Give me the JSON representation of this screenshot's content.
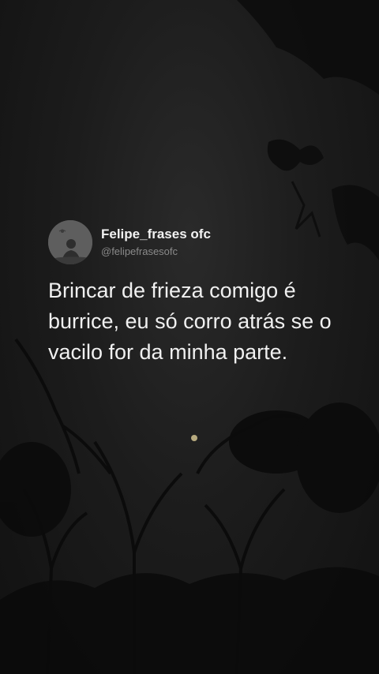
{
  "post": {
    "author_name": "Felipe_frases ofc",
    "author_handle": "@felipefrasesofc",
    "avatar_icon": "user-silhouette-icon",
    "quote_text": "Brincar de frieza comigo é burrice, eu só corro atrás se o vacilo for da minha parte."
  },
  "background": {
    "description_icon": "night-forest-trees",
    "moon_color": "#c8b98a",
    "base_color": "#161616"
  }
}
